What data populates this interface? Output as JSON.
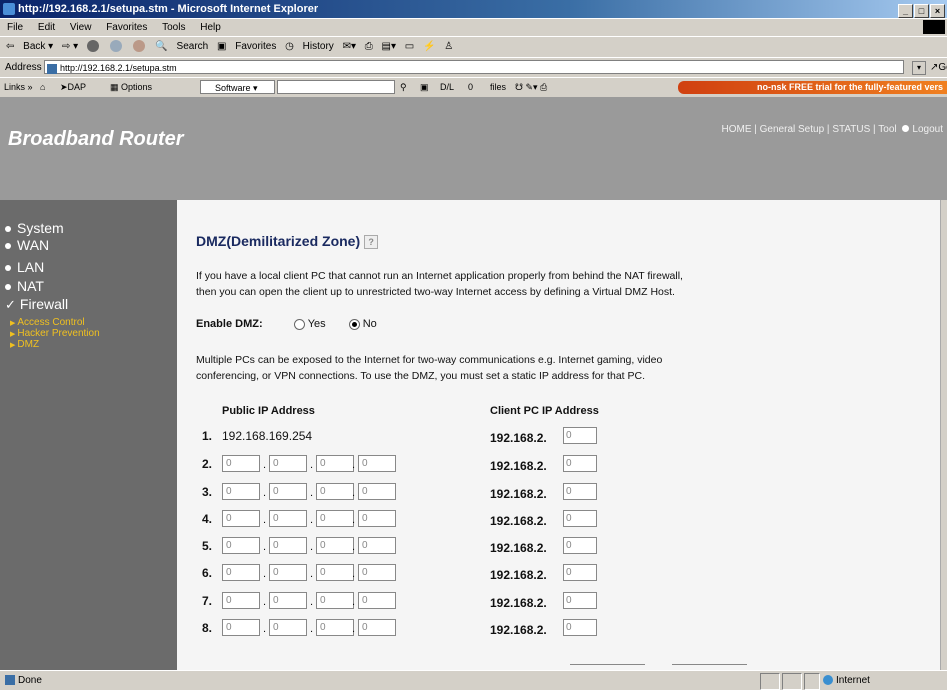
{
  "window": {
    "title": "http://192.168.2.1/setupa.stm - Microsoft Internet Explorer",
    "controls": [
      "_",
      "□",
      "×"
    ]
  },
  "menu": [
    "File",
    "Edit",
    "View",
    "Favorites",
    "Tools",
    "Help"
  ],
  "toolbar": {
    "back": "Back",
    "search": "Search",
    "favorites": "Favorites",
    "history": "History"
  },
  "address": {
    "label": "Address",
    "url": "http://192.168.2.1/setupa.stm",
    "go": "Go"
  },
  "links": {
    "label": "Links",
    "dap": "DAP",
    "options": "Options",
    "software": "Software",
    "dl": "D/L",
    "dl_count": "0",
    "files": "files",
    "promo": "no-nsk FREE trial for the fully-featured vers"
  },
  "header": {
    "brand": "Broadband Router",
    "nav": [
      "HOME",
      "General Setup",
      "STATUS",
      "Tool"
    ],
    "logout": "Logout"
  },
  "sidebar": {
    "items": [
      "System",
      "WAN",
      "LAN",
      "NAT",
      "Firewall"
    ],
    "subitems": [
      "Access Control",
      "Hacker Prevention",
      "DMZ"
    ]
  },
  "content": {
    "title": "DMZ(Demilitarized Zone)",
    "help_icon": "?",
    "intro1": "If you have a local client PC that cannot run an Internet application properly from behind the NAT firewall,",
    "intro2": "then you can open the client up to unrestricted two-way Internet access by defining a Virtual DMZ Host.",
    "enable_label": "Enable DMZ:",
    "opt_yes": "Yes",
    "opt_no": "No",
    "enable_selected": "No",
    "note1": "Multiple PCs can be exposed to the Internet for two-way communications e.g. Internet gaming, video",
    "note2": "conferencing, or VPN connections.  To use the DMZ, you must set a static IP address for that PC.",
    "col_public": "Public IP Address",
    "col_client": "Client PC IP Address",
    "client_prefix": "192.168.2.",
    "rows": [
      {
        "num": "1.",
        "public_static": "192.168.169.254",
        "client": "0"
      },
      {
        "num": "2.",
        "octets": [
          "0",
          "0",
          "0",
          "0"
        ],
        "client": "0"
      },
      {
        "num": "3.",
        "octets": [
          "0",
          "0",
          "0",
          "0"
        ],
        "client": "0"
      },
      {
        "num": "4.",
        "octets": [
          "0",
          "0",
          "0",
          "0"
        ],
        "client": "0"
      },
      {
        "num": "5.",
        "octets": [
          "0",
          "0",
          "0",
          "0"
        ],
        "client": "0"
      },
      {
        "num": "6.",
        "octets": [
          "0",
          "0",
          "0",
          "0"
        ],
        "client": "0"
      },
      {
        "num": "7.",
        "octets": [
          "0",
          "0",
          "0",
          "0"
        ],
        "client": "0"
      },
      {
        "num": "8.",
        "octets": [
          "0",
          "0",
          "0",
          "0"
        ],
        "client": "0"
      }
    ]
  },
  "status": {
    "text": "Done",
    "zone": "Internet"
  }
}
